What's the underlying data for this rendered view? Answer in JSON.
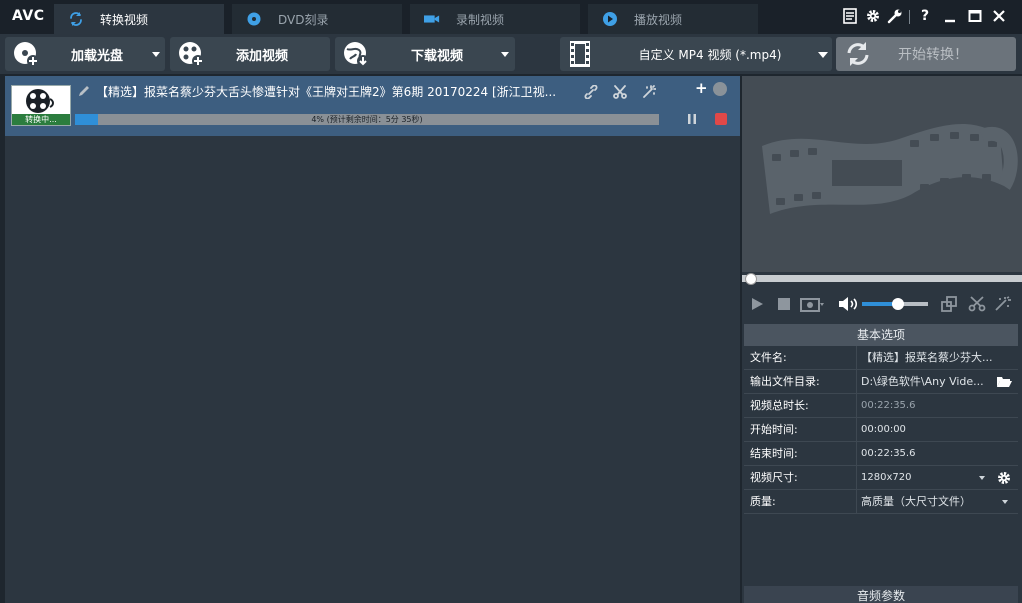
{
  "app": {
    "logo": "AVC"
  },
  "tabs": [
    {
      "label": "转换视频",
      "icon": "refresh-icon",
      "active": true
    },
    {
      "label": "DVD刻录",
      "icon": "disc-icon",
      "active": false
    },
    {
      "label": "录制视频",
      "icon": "camera-icon",
      "active": false
    },
    {
      "label": "播放视频",
      "icon": "play-circle-icon",
      "active": false
    }
  ],
  "toolbar": {
    "load_disc": "加载光盘",
    "add_video": "添加视频",
    "download_video": "下载视频",
    "format": "自定义 MP4 视频 (*.mp4)",
    "start": "开始转换！"
  },
  "job": {
    "title": "【精选】报菜名蔡少芬大舌头惨遭针对《王牌对王牌2》第6期 20170224 [浙江卫视...",
    "status": "转换中...",
    "progress_percent": 4,
    "progress_text": "4% (预计剩余时间：5分 35秒)"
  },
  "player": {
    "volume_percent": 55,
    "seek_percent": 0
  },
  "props": {
    "header": "基本选项",
    "rows": [
      {
        "key": "文件名:",
        "value": "【精选】报菜名蔡少芬大..."
      },
      {
        "key": "输出文件目录:",
        "value": "D:\\绿色软件\\Any Vide..."
      },
      {
        "key": "视频总时长:",
        "value": "00:22:35.6"
      },
      {
        "key": "开始时间:",
        "value": "00:00:00"
      },
      {
        "key": "结束时间:",
        "value": "00:22:35.6"
      },
      {
        "key": "视频尺寸:",
        "value": "1280x720"
      },
      {
        "key": "质量:",
        "value": "高质量（大尺寸文件）"
      }
    ],
    "audio_header": "音频参数"
  },
  "colors": {
    "accent": "#2f8fd8",
    "selection": "#3d5e80",
    "record": "#e04848"
  }
}
